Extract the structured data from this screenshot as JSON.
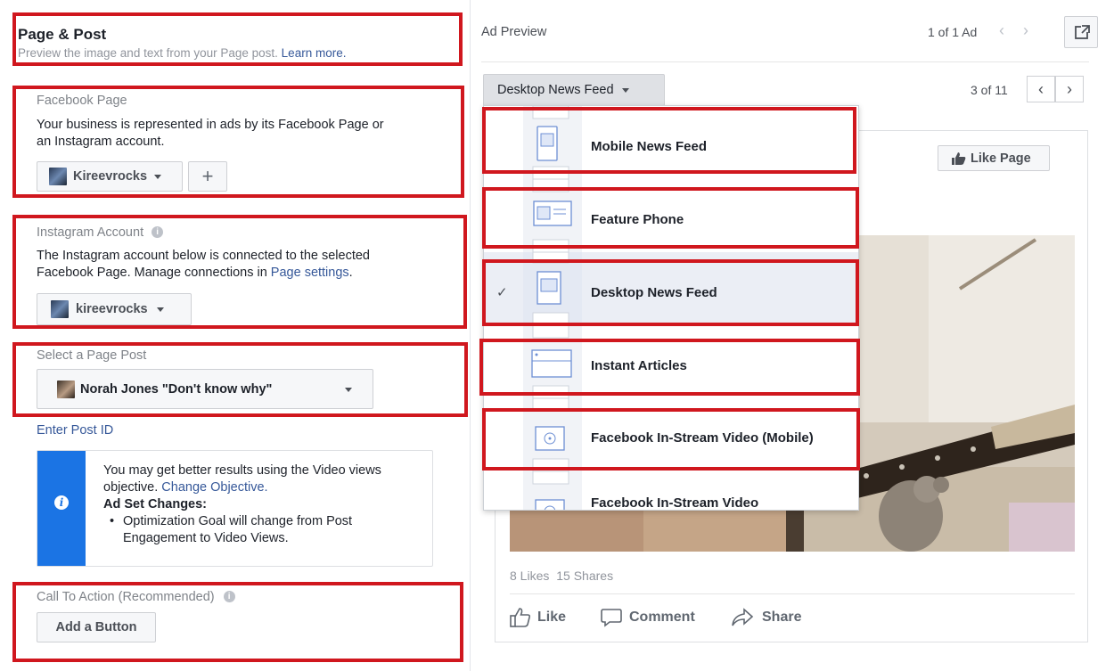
{
  "left": {
    "title": "Page & Post",
    "subtitle": "Preview the image and text from your Page post.",
    "learn_more": "Learn more.",
    "facebook_page": {
      "label": "Facebook Page",
      "description_1": "Your business is represented in ads by its Facebook Page or",
      "description_2": "an Instagram account.",
      "selected": "Kireevrocks",
      "add_symbol": "+"
    },
    "instagram": {
      "label": "Instagram Account",
      "description_1": "The Instagram account below is connected to the selected",
      "description_2": "Facebook Page. Manage connections in",
      "settings_link": "Page settings",
      "period": ".",
      "selected": "kireevrocks"
    },
    "page_post": {
      "label": "Select a Page Post",
      "selected": "Norah Jones \"Don't know why\""
    },
    "enter_post_id": "Enter Post ID",
    "notice": {
      "line_1": "You may get better results using the Video views",
      "line_2_text": "objective.",
      "change_objective": "Change Objective.",
      "heading": "Ad Set Changes:",
      "bullet_1": "Optimization Goal will change from Post",
      "bullet_2": "Engagement to Video Views."
    },
    "cta": {
      "label": "Call To Action (Recommended)",
      "button": "Add a Button"
    }
  },
  "right": {
    "title": "Ad Preview",
    "ad_counter": "1 of 1 Ad",
    "placement_select": "Desktop News Feed",
    "placement_counter": "3 of 11",
    "like_page": "Like Page",
    "stats_likes": "8 Likes",
    "stats_shares": "15 Shares",
    "actions": {
      "like": "Like",
      "comment": "Comment",
      "share": "Share"
    },
    "menu_items": [
      {
        "label": "Mobile News Feed",
        "selected": false
      },
      {
        "label": "Feature Phone",
        "selected": false
      },
      {
        "label": "Desktop News Feed",
        "selected": true
      },
      {
        "label": "Instant Articles",
        "selected": false
      },
      {
        "label": "Facebook In-Stream Video (Mobile)",
        "selected": false
      },
      {
        "label": "Facebook In-Stream Video",
        "selected": false
      }
    ],
    "check_mark": "✓"
  },
  "colors": {
    "annotation_red": "#d0171e",
    "link_blue": "#365899",
    "notice_blue": "#1b74e4"
  }
}
